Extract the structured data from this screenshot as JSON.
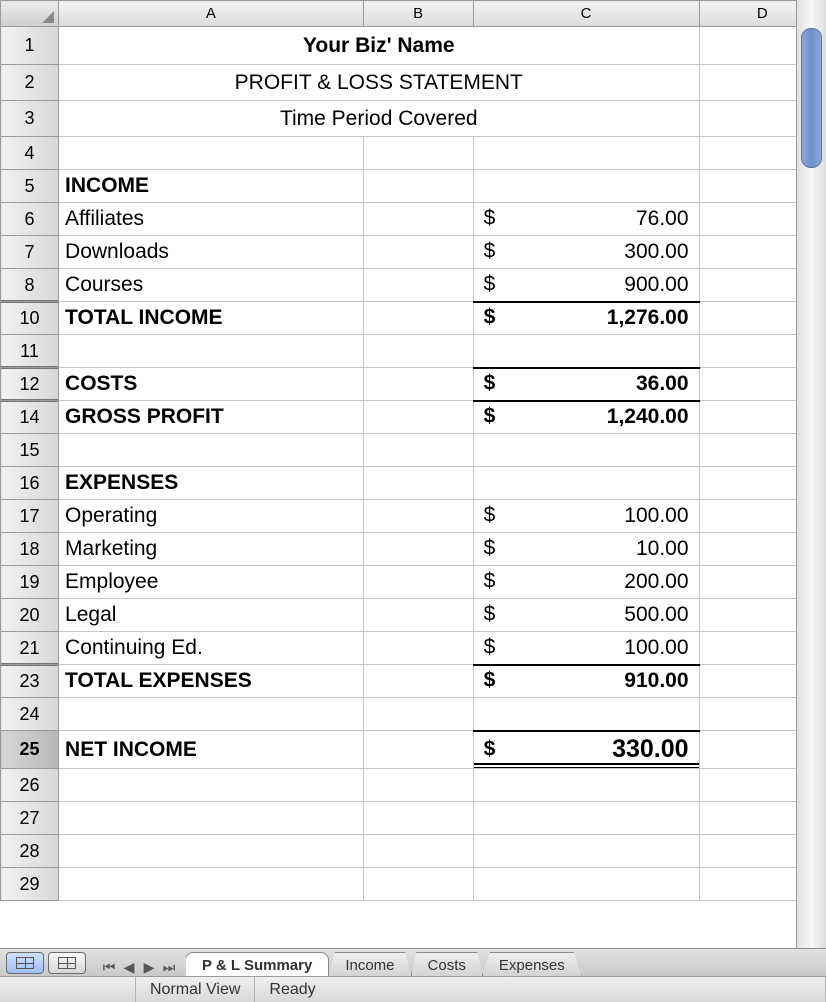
{
  "columns": [
    "A",
    "B",
    "C",
    "D"
  ],
  "title": "Your Biz' Name",
  "subtitle": "PROFIT & LOSS STATEMENT",
  "period": "Time Period Covered",
  "labels": {
    "income": "INCOME",
    "total_income": "TOTAL INCOME",
    "costs": "COSTS",
    "gross_profit": "GROSS PROFIT",
    "expenses": "EXPENSES",
    "total_expenses": "TOTAL EXPENSES",
    "net_income": "NET INCOME"
  },
  "income_items": [
    {
      "label": "Affiliates",
      "value": "76.00"
    },
    {
      "label": "Downloads",
      "value": "300.00"
    },
    {
      "label": "Courses",
      "value": "900.00"
    }
  ],
  "totals": {
    "total_income": "1,276.00",
    "costs": "36.00",
    "gross_profit": "1,240.00",
    "total_expenses": "910.00",
    "net_income": "330.00"
  },
  "expense_items": [
    {
      "label": "Operating",
      "value": "100.00"
    },
    {
      "label": "Marketing",
      "value": "10.00"
    },
    {
      "label": "Employee",
      "value": "200.00"
    },
    {
      "label": "Legal",
      "value": "500.00"
    },
    {
      "label": "Continuing Ed.",
      "value": "100.00"
    }
  ],
  "row_numbers": [
    "1",
    "2",
    "3",
    "4",
    "5",
    "6",
    "7",
    "8",
    "10",
    "11",
    "12",
    "14",
    "15",
    "16",
    "17",
    "18",
    "19",
    "20",
    "21",
    "23",
    "24",
    "25",
    "26",
    "27",
    "28",
    "29"
  ],
  "collapsed_rows": [
    "10",
    "12",
    "14",
    "23"
  ],
  "selected_row": "25",
  "tabs": [
    {
      "label": "P & L Summary",
      "active": true
    },
    {
      "label": "Income",
      "active": false
    },
    {
      "label": "Costs",
      "active": false
    },
    {
      "label": "Expenses",
      "active": false
    }
  ],
  "status": {
    "view": "Normal View",
    "ready": "Ready"
  },
  "currency_symbol": "$"
}
